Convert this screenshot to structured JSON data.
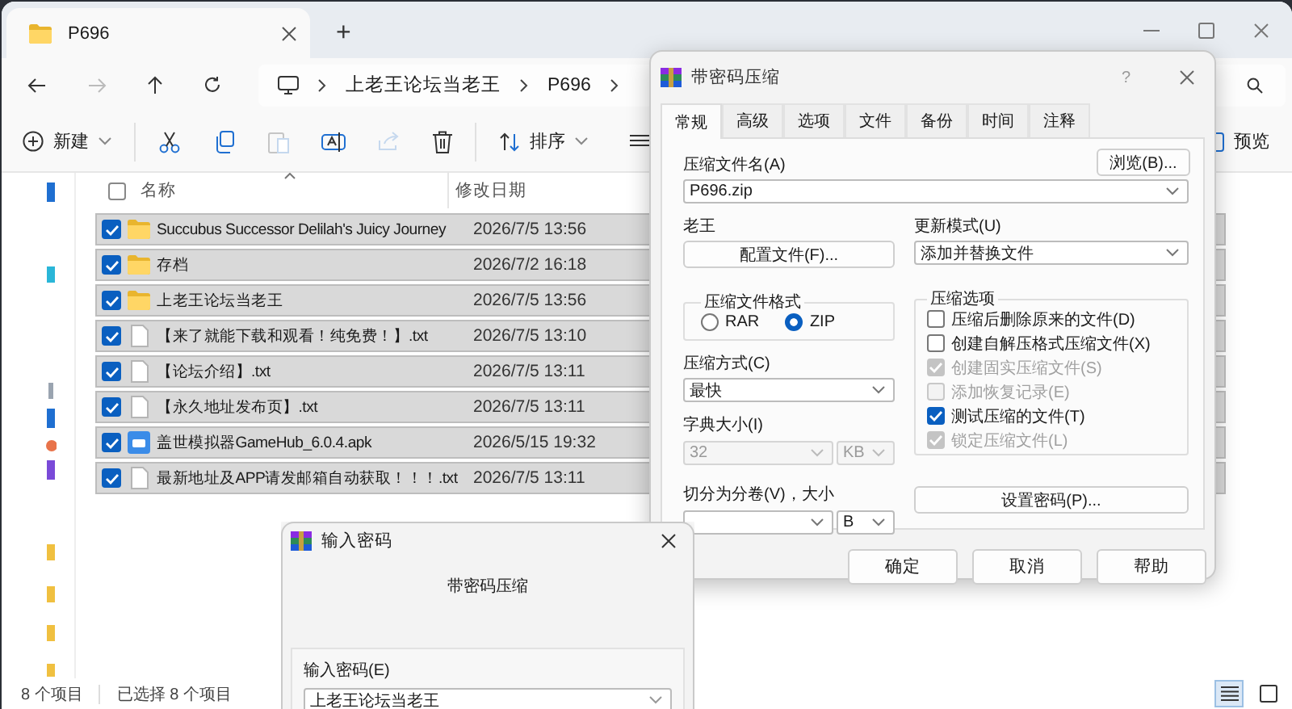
{
  "explorer": {
    "tabs": [
      {
        "label": "P696",
        "selected": true
      }
    ],
    "new_tab": "+",
    "address": [
      "上老王论坛当老王",
      "P696"
    ],
    "toolbar": {
      "new": "新建",
      "sort": "排序",
      "preview": "预览"
    },
    "columns": [
      "名称",
      "修改日期"
    ],
    "select_all": {
      "checked": false
    },
    "files": [
      {
        "name": "Succubus Successor Delilah's Juicy Journey",
        "date": "2026/7/5 13:56",
        "kind": "folder",
        "checked": true,
        "selected": true
      },
      {
        "name": "存档",
        "date": "2026/7/2 16:18",
        "kind": "folder",
        "checked": true,
        "selected": true
      },
      {
        "name": "上老王论坛当老王",
        "date": "2026/7/5 13:56",
        "kind": "folder",
        "checked": true,
        "selected": true
      },
      {
        "name": "【来了就能下载和观看！纯免费！】.txt",
        "date": "2026/7/5 13:10",
        "kind": "text",
        "checked": true,
        "selected": true
      },
      {
        "name": "【论坛介绍】.txt",
        "date": "2026/7/5 13:11",
        "kind": "text",
        "checked": true,
        "selected": true
      },
      {
        "name": "【永久地址发布页】.txt",
        "date": "2026/7/5 13:11",
        "kind": "text",
        "checked": true,
        "selected": true
      },
      {
        "name": "盖世模拟器GameHub_6.0.4.apk",
        "date": "2026/5/15 19:32",
        "kind": "apk",
        "checked": true,
        "selected": true
      },
      {
        "name": "最新地址及APP请发邮箱自动获取！！！.txt",
        "date": "2026/7/5 13:11",
        "kind": "text",
        "checked": true,
        "selected": true
      }
    ],
    "status": {
      "count": "8 个项目",
      "selected": "已选择 8 个项目"
    }
  },
  "archive_dialog": {
    "title": "带密码压缩",
    "help": "?",
    "tabs": [
      {
        "label": "常规",
        "selected": true
      },
      {
        "label": "高级",
        "selected": false
      },
      {
        "label": "选项",
        "selected": false
      },
      {
        "label": "文件",
        "selected": false
      },
      {
        "label": "备份",
        "selected": false
      },
      {
        "label": "时间",
        "selected": false
      },
      {
        "label": "注释",
        "selected": false
      }
    ],
    "archive_name": {
      "label": "压缩文件名(A)",
      "value": "P696.zip"
    },
    "browse": "浏览(B)...",
    "profile": {
      "label": "老王",
      "button": "配置文件(F)..."
    },
    "update_mode": {
      "label": "更新模式(U)",
      "value": "添加并替换文件"
    },
    "format": {
      "label": "压缩文件格式",
      "options": [
        {
          "label": "RAR",
          "selected": false
        },
        {
          "label": "ZIP",
          "selected": true
        }
      ]
    },
    "method": {
      "label": "压缩方式(C)",
      "value": "最快"
    },
    "dictionary": {
      "label": "字典大小(I)",
      "value": "32",
      "unit": "KB",
      "disabled": true
    },
    "split": {
      "label": "切分为分卷(V)，大小",
      "unit": "B"
    },
    "options": {
      "label": "压缩选项",
      "items": [
        {
          "label": "压缩后删除原来的文件(D)",
          "checked": false,
          "disabled": false
        },
        {
          "label": "创建自解压格式压缩文件(X)",
          "checked": false,
          "disabled": false
        },
        {
          "label": "创建固实压缩文件(S)",
          "checked": true,
          "disabled": true
        },
        {
          "label": "添加恢复记录(E)",
          "checked": false,
          "disabled": true
        },
        {
          "label": "测试压缩的文件(T)",
          "checked": true,
          "disabled": false
        },
        {
          "label": "锁定压缩文件(L)",
          "checked": true,
          "disabled": true
        }
      ]
    },
    "set_password": "设置密码(P)...",
    "buttons": [
      "确定",
      "取消",
      "帮助"
    ]
  },
  "password_dialog": {
    "title": "输入密码",
    "subtitle": "带密码压缩",
    "field": {
      "label": "输入密码(E)",
      "value": "上老王论坛当老王"
    }
  }
}
